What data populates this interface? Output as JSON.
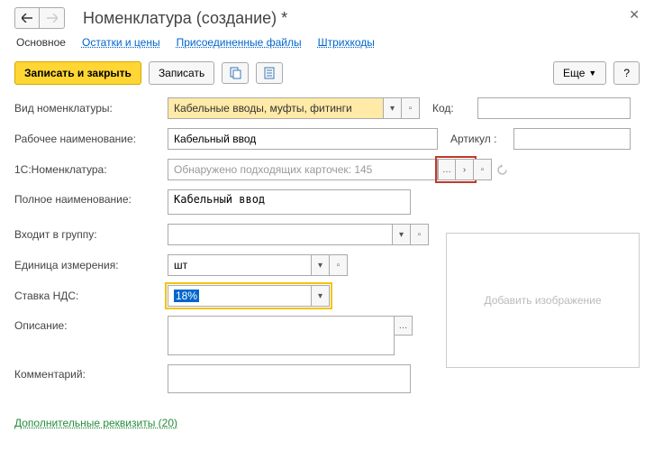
{
  "header": {
    "title": "Номенклатура (создание) *"
  },
  "tabs": {
    "main": "Основное",
    "balances": "Остатки и цены",
    "files": "Присоединенные файлы",
    "barcodes": "Штрихкоды"
  },
  "toolbar": {
    "save_close": "Записать и закрыть",
    "save": "Записать",
    "more": "Еще",
    "help": "?"
  },
  "labels": {
    "type": "Вид номенклатуры:",
    "working_name": "Рабочее наименование:",
    "onec": "1С:Номенклатура:",
    "full_name": "Полное наименование:",
    "group": "Входит в группу:",
    "unit": "Единица измерения:",
    "vat": "Ставка НДС:",
    "description": "Описание:",
    "comment": "Комментарий:",
    "code": "Код:",
    "article": "Артикул :"
  },
  "values": {
    "type": "Кабельные вводы, муфты, фитинги",
    "working_name": "Кабельный ввод",
    "onec_placeholder": "Обнаружено подходящих карточек: 145",
    "full_name": "Кабельный ввод",
    "group": "",
    "unit": "шт",
    "vat": "18%",
    "description": "",
    "comment": "",
    "code": "",
    "article": ""
  },
  "image_placeholder": "Добавить изображение",
  "bottom_link": "Дополнительные реквизиты (20)"
}
